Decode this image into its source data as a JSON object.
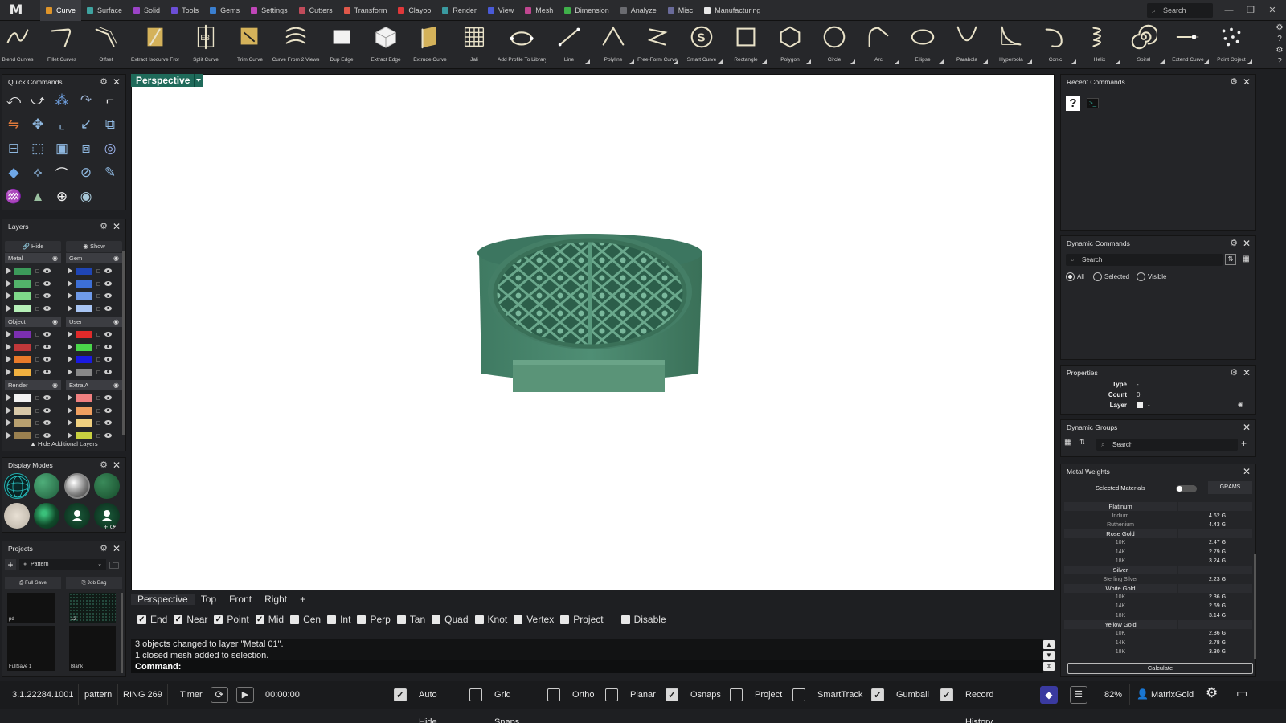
{
  "app": {
    "logo": "M"
  },
  "tabs": [
    {
      "label": "Curve",
      "color": "#e0952a"
    },
    {
      "label": "Surface",
      "color": "#3fa3a0"
    },
    {
      "label": "Solid",
      "color": "#9b43c7"
    },
    {
      "label": "Tools",
      "color": "#6b4ed6"
    },
    {
      "label": "Gems",
      "color": "#3a7fd0"
    },
    {
      "label": "Settings",
      "color": "#c046b8"
    },
    {
      "label": "Cutters",
      "color": "#c04b5a"
    },
    {
      "label": "Transform",
      "color": "#e0584a"
    },
    {
      "label": "Clayoo",
      "color": "#e0383a"
    },
    {
      "label": "Render",
      "color": "#3a9aa0"
    },
    {
      "label": "View",
      "color": "#4a5ad6"
    },
    {
      "label": "Mesh",
      "color": "#c04690"
    },
    {
      "label": "Dimension",
      "color": "#3fb04a"
    },
    {
      "label": "Analyze",
      "color": "#6a6b70"
    },
    {
      "label": "Misc",
      "color": "#6a6b9a"
    },
    {
      "label": "Manufacturing",
      "color": "#e8e8e8"
    }
  ],
  "top_search": "Search",
  "ribbon": [
    {
      "label": "Blend Curves",
      "icon": "blend-curves-icon"
    },
    {
      "label": "Fillet Curves",
      "icon": "fillet-curves-icon"
    },
    {
      "label": "Offset",
      "icon": "offset-icon"
    },
    {
      "label": "Extract Isocurve From...",
      "icon": "extract-isocurve-icon"
    },
    {
      "label": "Split Curve",
      "icon": "split-curve-icon"
    },
    {
      "label": "Trim Curve",
      "icon": "trim-curve-icon"
    },
    {
      "label": "Curve From 2 Views",
      "icon": "curve-from-2-views-icon"
    },
    {
      "label": "Dup Edge",
      "icon": "dup-edge-icon"
    },
    {
      "label": "Extract Edge",
      "icon": "extract-edge-icon"
    },
    {
      "label": "Extrude Curve",
      "icon": "extrude-curve-icon"
    },
    {
      "label": "Jali",
      "icon": "jali-icon"
    },
    {
      "label": "Add Profile To Library",
      "icon": "add-profile-icon"
    },
    {
      "label": "Line",
      "icon": "line-icon"
    },
    {
      "label": "Polyline",
      "icon": "polyline-icon"
    },
    {
      "label": "Free-Form Curve",
      "icon": "free-form-curve-icon"
    },
    {
      "label": "Smart Curve",
      "icon": "smart-curve-icon"
    },
    {
      "label": "Rectangle",
      "icon": "rectangle-icon"
    },
    {
      "label": "Polygon",
      "icon": "polygon-icon"
    },
    {
      "label": "Circle",
      "icon": "circle-icon"
    },
    {
      "label": "Arc",
      "icon": "arc-icon"
    },
    {
      "label": "Ellipse",
      "icon": "ellipse-icon"
    },
    {
      "label": "Parabola",
      "icon": "parabola-icon"
    },
    {
      "label": "Hyperbola",
      "icon": "hyperbola-icon"
    },
    {
      "label": "Conic",
      "icon": "conic-icon"
    },
    {
      "label": "Helix",
      "icon": "helix-icon"
    },
    {
      "label": "Spiral",
      "icon": "spiral-icon"
    },
    {
      "label": "Extend Curve",
      "icon": "extend-curve-icon"
    },
    {
      "label": "Point Object",
      "icon": "point-object-icon"
    }
  ],
  "quick_commands": {
    "title": "Quick Commands"
  },
  "layers": {
    "title": "Layers",
    "hide_label": "Hide",
    "show_label": "Show",
    "groups": [
      {
        "name": "Metal",
        "colors": [
          "#3c9a5a",
          "#52b36a",
          "#7fd98a",
          "#b6f0b8"
        ]
      },
      {
        "name": "Gem",
        "colors": [
          "#1f45b5",
          "#3d6fd6",
          "#6f9ae8",
          "#a8c4f2"
        ]
      },
      {
        "name": "Object",
        "colors": [
          "#7b2fb0",
          "#c0383a",
          "#e87a2a",
          "#f0b040"
        ]
      },
      {
        "name": "User",
        "colors": [
          "#e02a2a",
          "#4ad64a",
          "#1a1ae0",
          "#888888"
        ]
      },
      {
        "name": "Render",
        "colors": [
          "#f2f2f2",
          "#d8c8a8",
          "#b8a070",
          "#9a8050"
        ]
      },
      {
        "name": "Extra A",
        "colors": [
          "#f08080",
          "#f0a060",
          "#f0d080",
          "#c8d040"
        ]
      }
    ],
    "hide_additional": "Hide Additional Layers"
  },
  "display_modes": {
    "title": "Display Modes"
  },
  "projects": {
    "title": "Projects",
    "selected": "Pattern",
    "full_save": "Full Save",
    "job_bag": "Job Bag",
    "thumbs": [
      "pd",
      "12",
      "FullSave 1",
      "Blank"
    ]
  },
  "viewport": {
    "active": "Perspective"
  },
  "view_tabs": [
    "Perspective",
    "Top",
    "Front",
    "Right",
    "+"
  ],
  "snaps": [
    {
      "label": "End",
      "on": true
    },
    {
      "label": "Near",
      "on": true
    },
    {
      "label": "Point",
      "on": true
    },
    {
      "label": "Mid",
      "on": true
    },
    {
      "label": "Cen",
      "on": false
    },
    {
      "label": "Int",
      "on": false
    },
    {
      "label": "Perp",
      "on": false
    },
    {
      "label": "Tan",
      "on": false
    },
    {
      "label": "Quad",
      "on": false
    },
    {
      "label": "Knot",
      "on": false
    },
    {
      "label": "Vertex",
      "on": false
    },
    {
      "label": "Project",
      "on": false
    },
    {
      "label": "Disable",
      "on": false
    }
  ],
  "command_log": [
    "3 objects changed to layer \"Metal 01\".",
    "1 closed mesh added to selection."
  ],
  "command_prompt": "Command:",
  "recent_commands": {
    "title": "Recent Commands"
  },
  "dynamic_commands": {
    "title": "Dynamic Commands",
    "search": "Search",
    "radios": [
      "All",
      "Selected",
      "Visible"
    ]
  },
  "properties": {
    "title": "Properties",
    "type_label": "Type",
    "type_value": "-",
    "count_label": "Count",
    "count_value": "0",
    "layer_label": "Layer",
    "layer_value": "-"
  },
  "dynamic_groups": {
    "title": "Dynamic Groups",
    "search": "Search"
  },
  "metal_weights": {
    "title": "Metal Weights",
    "selected_materials": "Selected Materials",
    "unit": "GRAMS",
    "calculate": "Calculate",
    "groups": [
      {
        "name": "Platinum",
        "rows": [
          {
            "n": "Iridium",
            "v": "4.62 G"
          },
          {
            "n": "Ruthenium",
            "v": "4.43 G"
          }
        ]
      },
      {
        "name": "Rose Gold",
        "rows": [
          {
            "n": "10K",
            "v": "2.47 G"
          },
          {
            "n": "14K",
            "v": "2.79 G"
          },
          {
            "n": "18K",
            "v": "3.24 G"
          }
        ]
      },
      {
        "name": "Silver",
        "rows": [
          {
            "n": "Sterling Silver",
            "v": "2.23 G"
          }
        ]
      },
      {
        "name": "White Gold",
        "rows": [
          {
            "n": "10K",
            "v": "2.36 G"
          },
          {
            "n": "14K",
            "v": "2.69 G"
          },
          {
            "n": "18K",
            "v": "3.14 G"
          }
        ]
      },
      {
        "name": "Yellow Gold",
        "rows": [
          {
            "n": "10K",
            "v": "2.36 G"
          },
          {
            "n": "14K",
            "v": "2.78 G"
          },
          {
            "n": "18K",
            "v": "3.30 G"
          }
        ]
      }
    ]
  },
  "status": {
    "version": "3.1.22284.1001",
    "project": "pattern",
    "file": "RING 269",
    "timer_label": "Timer",
    "timer_value": "00:00:00",
    "toggles": [
      {
        "label": "Auto Hide",
        "on": true
      },
      {
        "label": "Grid Snaps",
        "on": false
      },
      {
        "label": "Ortho",
        "on": false
      },
      {
        "label": "Planar",
        "on": false
      },
      {
        "label": "Osnaps",
        "on": true
      },
      {
        "label": "Project",
        "on": false
      },
      {
        "label": "SmartTrack",
        "on": false
      },
      {
        "label": "Gumball",
        "on": true
      },
      {
        "label": "Record History",
        "on": true
      }
    ],
    "zoom": "82%",
    "user": "MatrixGold"
  }
}
